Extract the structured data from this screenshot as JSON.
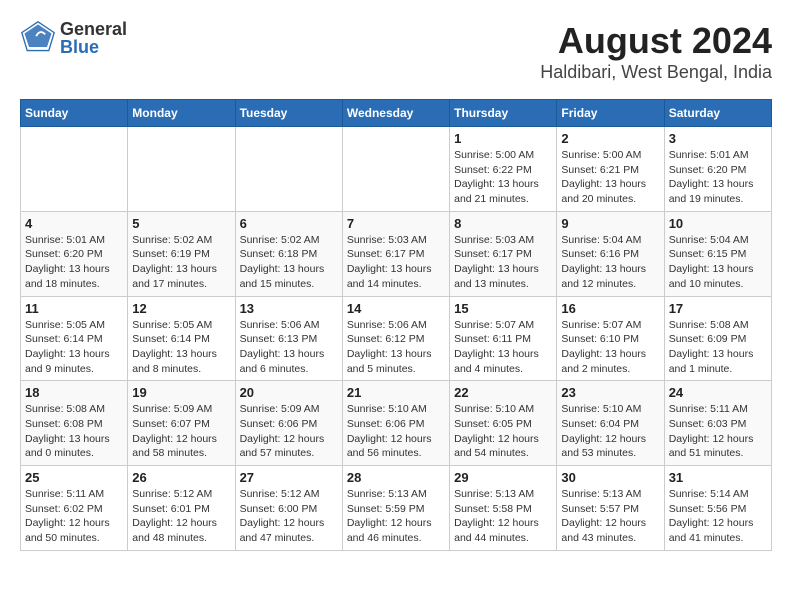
{
  "header": {
    "logo_general": "General",
    "logo_blue": "Blue",
    "title": "August 2024",
    "subtitle": "Haldibari, West Bengal, India"
  },
  "weekdays": [
    "Sunday",
    "Monday",
    "Tuesday",
    "Wednesday",
    "Thursday",
    "Friday",
    "Saturday"
  ],
  "weeks": [
    [
      {
        "day": "",
        "info": ""
      },
      {
        "day": "",
        "info": ""
      },
      {
        "day": "",
        "info": ""
      },
      {
        "day": "",
        "info": ""
      },
      {
        "day": "1",
        "info": "Sunrise: 5:00 AM\nSunset: 6:22 PM\nDaylight: 13 hours\nand 21 minutes."
      },
      {
        "day": "2",
        "info": "Sunrise: 5:00 AM\nSunset: 6:21 PM\nDaylight: 13 hours\nand 20 minutes."
      },
      {
        "day": "3",
        "info": "Sunrise: 5:01 AM\nSunset: 6:20 PM\nDaylight: 13 hours\nand 19 minutes."
      }
    ],
    [
      {
        "day": "4",
        "info": "Sunrise: 5:01 AM\nSunset: 6:20 PM\nDaylight: 13 hours\nand 18 minutes."
      },
      {
        "day": "5",
        "info": "Sunrise: 5:02 AM\nSunset: 6:19 PM\nDaylight: 13 hours\nand 17 minutes."
      },
      {
        "day": "6",
        "info": "Sunrise: 5:02 AM\nSunset: 6:18 PM\nDaylight: 13 hours\nand 15 minutes."
      },
      {
        "day": "7",
        "info": "Sunrise: 5:03 AM\nSunset: 6:17 PM\nDaylight: 13 hours\nand 14 minutes."
      },
      {
        "day": "8",
        "info": "Sunrise: 5:03 AM\nSunset: 6:17 PM\nDaylight: 13 hours\nand 13 minutes."
      },
      {
        "day": "9",
        "info": "Sunrise: 5:04 AM\nSunset: 6:16 PM\nDaylight: 13 hours\nand 12 minutes."
      },
      {
        "day": "10",
        "info": "Sunrise: 5:04 AM\nSunset: 6:15 PM\nDaylight: 13 hours\nand 10 minutes."
      }
    ],
    [
      {
        "day": "11",
        "info": "Sunrise: 5:05 AM\nSunset: 6:14 PM\nDaylight: 13 hours\nand 9 minutes."
      },
      {
        "day": "12",
        "info": "Sunrise: 5:05 AM\nSunset: 6:14 PM\nDaylight: 13 hours\nand 8 minutes."
      },
      {
        "day": "13",
        "info": "Sunrise: 5:06 AM\nSunset: 6:13 PM\nDaylight: 13 hours\nand 6 minutes."
      },
      {
        "day": "14",
        "info": "Sunrise: 5:06 AM\nSunset: 6:12 PM\nDaylight: 13 hours\nand 5 minutes."
      },
      {
        "day": "15",
        "info": "Sunrise: 5:07 AM\nSunset: 6:11 PM\nDaylight: 13 hours\nand 4 minutes."
      },
      {
        "day": "16",
        "info": "Sunrise: 5:07 AM\nSunset: 6:10 PM\nDaylight: 13 hours\nand 2 minutes."
      },
      {
        "day": "17",
        "info": "Sunrise: 5:08 AM\nSunset: 6:09 PM\nDaylight: 13 hours\nand 1 minute."
      }
    ],
    [
      {
        "day": "18",
        "info": "Sunrise: 5:08 AM\nSunset: 6:08 PM\nDaylight: 13 hours\nand 0 minutes."
      },
      {
        "day": "19",
        "info": "Sunrise: 5:09 AM\nSunset: 6:07 PM\nDaylight: 12 hours\nand 58 minutes."
      },
      {
        "day": "20",
        "info": "Sunrise: 5:09 AM\nSunset: 6:06 PM\nDaylight: 12 hours\nand 57 minutes."
      },
      {
        "day": "21",
        "info": "Sunrise: 5:10 AM\nSunset: 6:06 PM\nDaylight: 12 hours\nand 56 minutes."
      },
      {
        "day": "22",
        "info": "Sunrise: 5:10 AM\nSunset: 6:05 PM\nDaylight: 12 hours\nand 54 minutes."
      },
      {
        "day": "23",
        "info": "Sunrise: 5:10 AM\nSunset: 6:04 PM\nDaylight: 12 hours\nand 53 minutes."
      },
      {
        "day": "24",
        "info": "Sunrise: 5:11 AM\nSunset: 6:03 PM\nDaylight: 12 hours\nand 51 minutes."
      }
    ],
    [
      {
        "day": "25",
        "info": "Sunrise: 5:11 AM\nSunset: 6:02 PM\nDaylight: 12 hours\nand 50 minutes."
      },
      {
        "day": "26",
        "info": "Sunrise: 5:12 AM\nSunset: 6:01 PM\nDaylight: 12 hours\nand 48 minutes."
      },
      {
        "day": "27",
        "info": "Sunrise: 5:12 AM\nSunset: 6:00 PM\nDaylight: 12 hours\nand 47 minutes."
      },
      {
        "day": "28",
        "info": "Sunrise: 5:13 AM\nSunset: 5:59 PM\nDaylight: 12 hours\nand 46 minutes."
      },
      {
        "day": "29",
        "info": "Sunrise: 5:13 AM\nSunset: 5:58 PM\nDaylight: 12 hours\nand 44 minutes."
      },
      {
        "day": "30",
        "info": "Sunrise: 5:13 AM\nSunset: 5:57 PM\nDaylight: 12 hours\nand 43 minutes."
      },
      {
        "day": "31",
        "info": "Sunrise: 5:14 AM\nSunset: 5:56 PM\nDaylight: 12 hours\nand 41 minutes."
      }
    ]
  ]
}
